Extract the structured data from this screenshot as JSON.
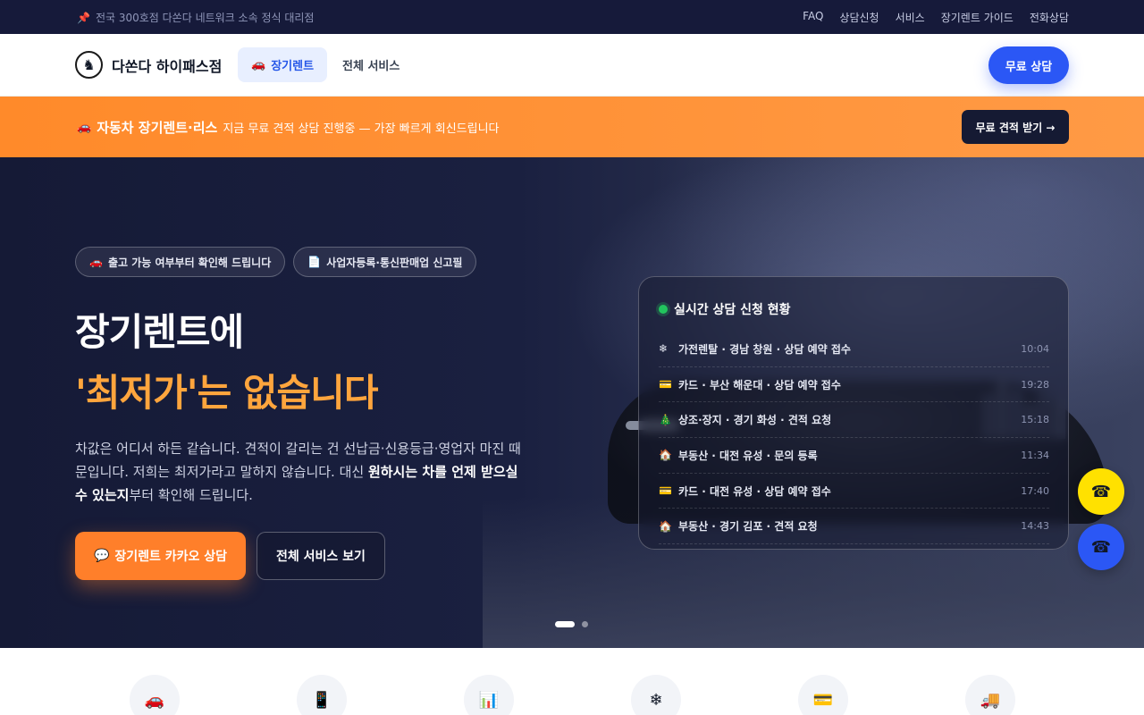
{
  "topbar": {
    "notice": "전국 300호점 다쏜다 네트워크 소속 정식 대리점",
    "links": [
      "FAQ",
      "상담신청",
      "서비스",
      "장기렌트 가이드",
      "전화상담"
    ]
  },
  "nav": {
    "brand": "다쏜다 하이패스점",
    "tab_active": "장기렌트",
    "tab": "전체 서비스",
    "cta": "무료 상담"
  },
  "promo": {
    "title": "자동차 장기렌트·리스",
    "text": "지금 무료 견적 상담 진행중 — 가장 빠르게 회신드립니다",
    "button": "무료 견적 받기 →"
  },
  "hero": {
    "chips": [
      "출고 가능 여부부터 확인해 드립니다",
      "사업자등록·통신판매업 신고필"
    ],
    "title_line1": "장기렌트에",
    "title_line2": "'최저가'는 없습니다",
    "desc_part1": "차값은 어디서 하든 같습니다. 견적이 갈리는 건 선납금·신용등급·영업자 마진 때문입니다. 저희는 최저가라고 말하지 않습니다. 대신 ",
    "desc_bold": "원하시는 차를 언제 받으실 수 있는지",
    "desc_part2": "부터 확인해 드립니다.",
    "btn_kakao": "장기렌트 카카오 상담",
    "btn_all": "전체 서비스 보기"
  },
  "live": {
    "title": "실시간 상담 신청 현황",
    "rows": [
      {
        "icon": "❄",
        "text": "가전렌탈 · 경남 창원 · 상담 예약 접수",
        "time": "10:04"
      },
      {
        "icon": "💳",
        "text": "카드 · 부산 해운대 · 상담 예약 접수",
        "time": "19:28"
      },
      {
        "icon": "🎄",
        "text": "상조·장지 · 경기 화성 · 견적 요청",
        "time": "15:18"
      },
      {
        "icon": "🏠",
        "text": "부동산 · 대전 유성 · 문의 등록",
        "time": "11:34"
      },
      {
        "icon": "💳",
        "text": "카드 · 대전 유성 · 상담 예약 접수",
        "time": "17:40"
      },
      {
        "icon": "🏠",
        "text": "부동산 · 경기 김포 · 견적 요청",
        "time": "14:43"
      }
    ]
  },
  "services": {
    "icons": [
      "🚗",
      "📱",
      "📊",
      "❄",
      "💳",
      "🚚"
    ]
  }
}
